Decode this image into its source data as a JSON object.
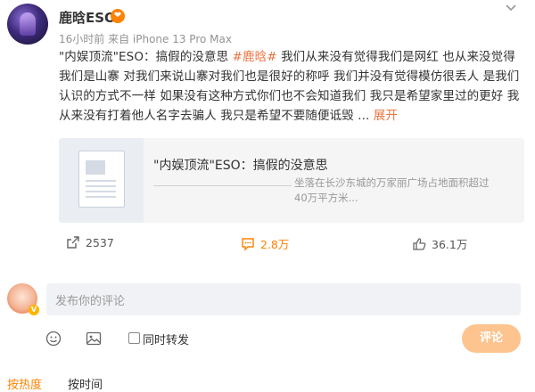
{
  "post": {
    "username": "鹿晗ESO",
    "vip_badge": "❤",
    "meta": "16小时前  来自 iPhone 13 Pro Max",
    "more_icon": "chevron-down",
    "text_before": "\"内娱顶流\"ESO：搞假的没意思 ",
    "hashtag": "#鹿晗#",
    "text_after": " 我们从来没有觉得我们是网红 也从来没觉得我们是山寨 对我们来说山寨对我们也是很好的称呼 我们并没有觉得模仿很丢人 是我们认识的方式不一样 如果没有这种方式你们也不会知道我们 我只是希望家里过的更好 我从来没有打着他人名字去骗人 我只是希望不要随便诋毁 ",
    "ellipsis": "...",
    "expand": " 展开"
  },
  "card": {
    "title": "\"内娱顶流\"ESO：搞假的没意思",
    "desc": "坐落在长沙东城的万家丽广场占地面积超过40万平方米..."
  },
  "actions": {
    "repost_count": "2537",
    "comment_count": "2.8万",
    "like_count": "36.1万"
  },
  "comment_box": {
    "placeholder": "发布你的评论",
    "also_repost": "同时转发",
    "submit": "评论"
  },
  "sort": {
    "hot": "按热度",
    "time": "按时间"
  },
  "colors": {
    "accent": "#ff8200",
    "tag": "#eb7340",
    "submit_bg": "#fdc48f"
  }
}
